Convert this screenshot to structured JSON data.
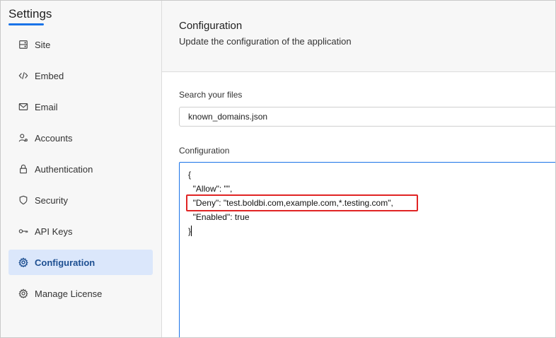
{
  "sidebar": {
    "title": "Settings",
    "items": [
      {
        "label": "Site",
        "icon": "server-icon",
        "active": false
      },
      {
        "label": "Embed",
        "icon": "code-icon",
        "active": false
      },
      {
        "label": "Email",
        "icon": "mail-icon",
        "active": false
      },
      {
        "label": "Accounts",
        "icon": "user-settings-icon",
        "active": false
      },
      {
        "label": "Authentication",
        "icon": "lock-icon",
        "active": false
      },
      {
        "label": "Security",
        "icon": "shield-icon",
        "active": false
      },
      {
        "label": "API Keys",
        "icon": "key-icon",
        "active": false
      },
      {
        "label": "Configuration",
        "icon": "gear-icon",
        "active": true
      },
      {
        "label": "Manage License",
        "icon": "license-gear-icon",
        "active": false
      }
    ]
  },
  "header": {
    "title": "Configuration",
    "subtitle": "Update the configuration of the application"
  },
  "search": {
    "label": "Search your files",
    "value": "known_domains.json"
  },
  "config": {
    "label": "Configuration",
    "lines": [
      "{",
      "  \"Allow\": \"\",",
      "  \"Deny\": \"test.boldbi.com,example.com,*.testing.com\",",
      "  \"Enabled\": true",
      "}"
    ]
  },
  "colors": {
    "accent": "#1a73e8",
    "active_bg": "#dbe7fb",
    "highlight": "#e02424"
  }
}
